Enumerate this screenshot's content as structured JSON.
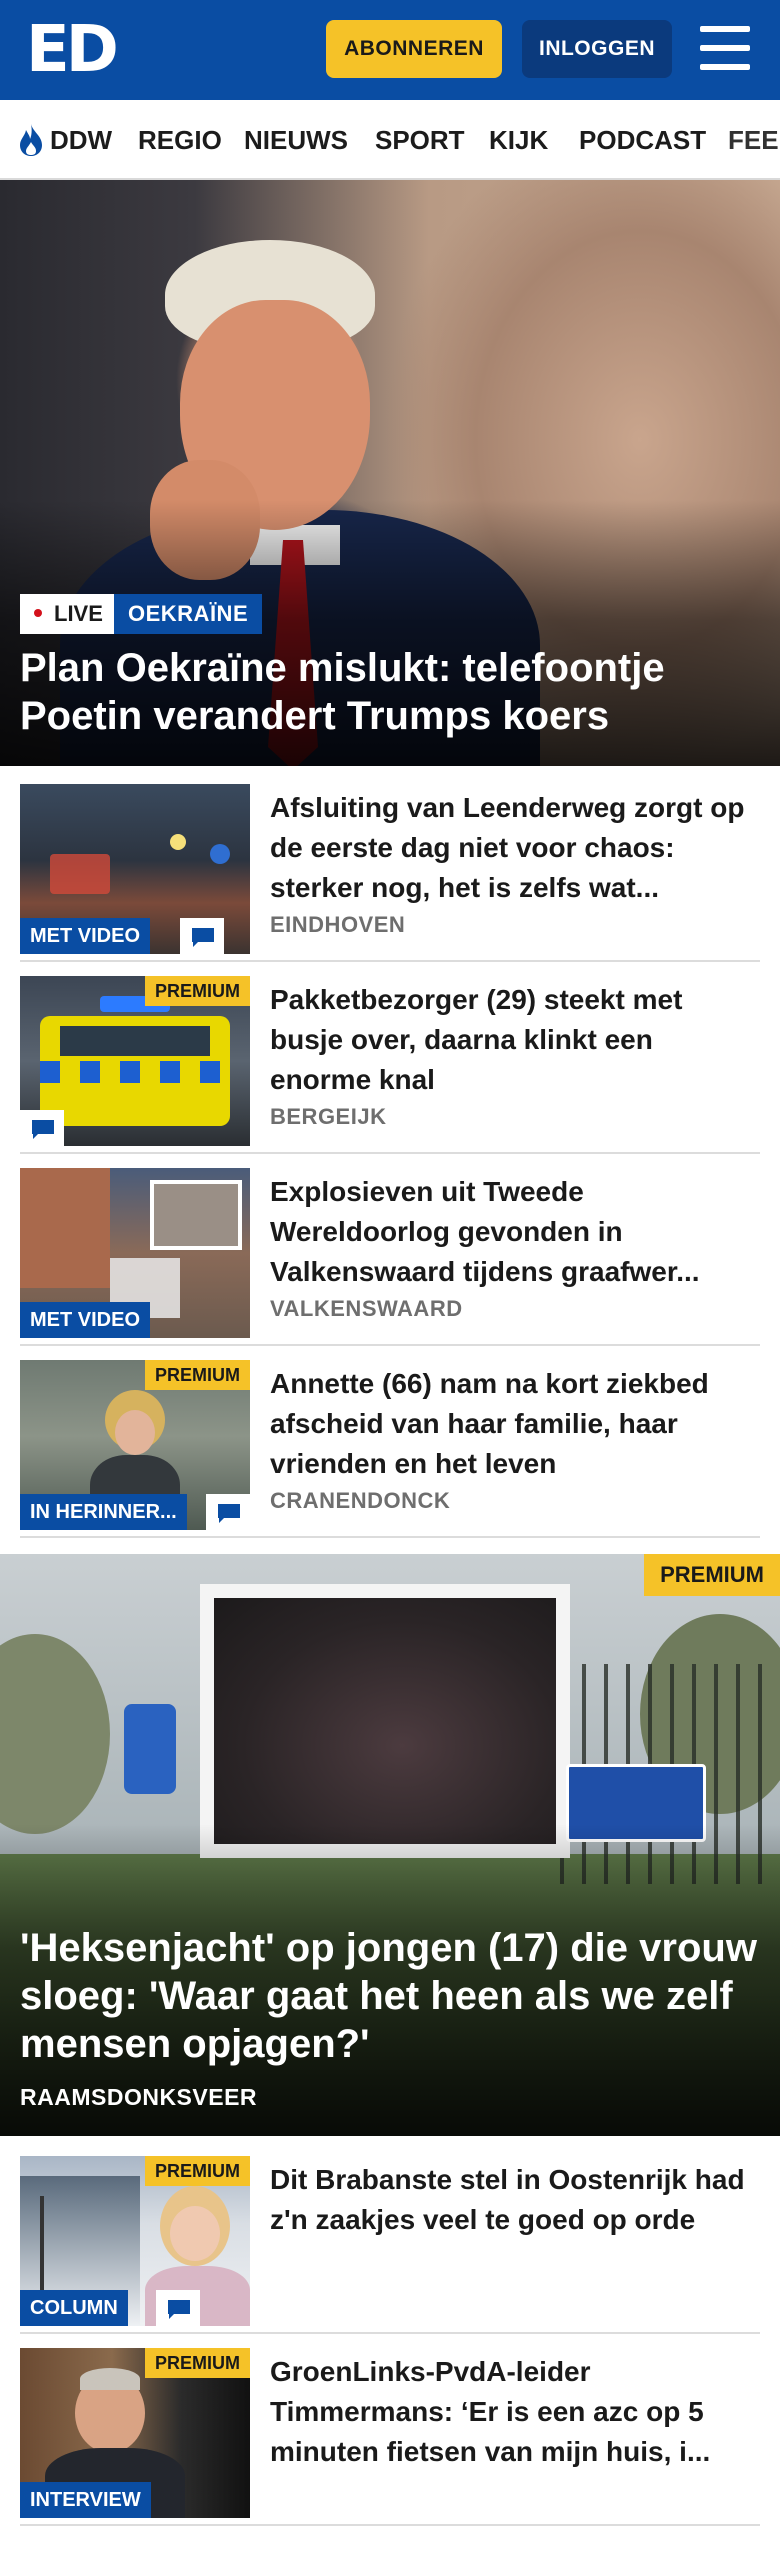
{
  "header": {
    "logo_text": "ED",
    "subscribe_label": "ABONNEREN",
    "login_label": "INLOGGEN",
    "menu_icon": "hamburger-menu-icon"
  },
  "nav": {
    "items": [
      "DDW",
      "REGIO",
      "NIEUWS",
      "SPORT",
      "KIJK",
      "PODCAST",
      "FEE"
    ],
    "first_item_icon": "flame-icon"
  },
  "hero": {
    "live_label": "LIVE",
    "category": "OEKRAÏNE",
    "title": "Plan Oekraïne mislukt: telefoontje Poetin verandert Trumps koers"
  },
  "articles": [
    {
      "title": "Afsluiting van Leenderweg zorgt op de eerste dag niet voor chaos: sterker nog, het is zelfs wat...",
      "location": "EINDHOVEN",
      "tag": "MET VIDEO"
    },
    {
      "title": "Pakketbezorger (29) steekt met busje over, daarna klinkt een enorme knal",
      "location": "BERGEIJK",
      "premium": "PREMIUM"
    },
    {
      "title": "Explosieven uit Tweede Wereldoorlog gevonden in Valkenswaard tijdens graafwer...",
      "location": "VALKENSWAARD",
      "tag": "MET VIDEO"
    },
    {
      "title": "Annette (66) nam na kort ziekbed afscheid van haar familie, haar vrienden en het leven",
      "location": "CRANENDONCK",
      "tag": "IN HERINNER...",
      "premium": "PREMIUM"
    }
  ],
  "feature": {
    "premium": "PREMIUM",
    "title": "'Heksenjacht' op jongen (17) die vrouw sloeg: 'Waar gaat het heen als we zelf mensen opjagen?'",
    "location": "RAAMSDONKSVEER"
  },
  "articles_more": [
    {
      "title": "Dit Brabanste stel in Oostenrijk had z'n zaakjes veel te goed op orde",
      "tag": "COLUMN",
      "premium": "PREMIUM"
    },
    {
      "title": "GroenLinks-PvdA-leider Timmermans: ‘Er is een azc op 5 minuten fietsen van mijn huis, i...",
      "tag": "INTERVIEW",
      "premium": "PREMIUM"
    }
  ],
  "colors": {
    "brand_blue": "#0a4da3",
    "premium_yellow": "#f5c228",
    "live_red": "#d3111b"
  }
}
